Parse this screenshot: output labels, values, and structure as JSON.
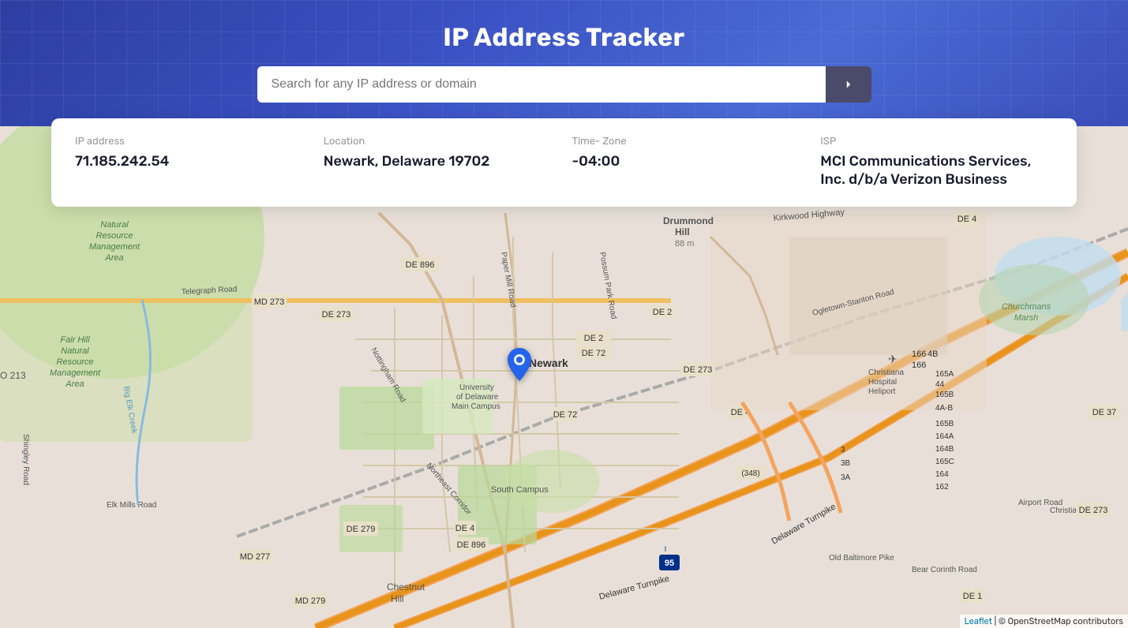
{
  "app": {
    "title": "IP Address Tracker"
  },
  "search": {
    "placeholder": "Search for any IP address or domain",
    "current_value": ""
  },
  "info": {
    "ip_label": "IP address",
    "ip_value": "71.185.242.54",
    "location_label": "Location",
    "location_value": "Newark, Delaware 19702",
    "timezone_label": "Time- Zone",
    "timezone_value": "-04:00",
    "isp_label": "ISP",
    "isp_value": "MCI Communications Services, Inc. d/b/a Verizon Business"
  },
  "map": {
    "attribution": "Leaflet",
    "attribution_link": "https://leafletjs.com",
    "pin_lat": 39.68,
    "pin_lng": -75.75
  },
  "buttons": {
    "search_arrow": "›"
  }
}
